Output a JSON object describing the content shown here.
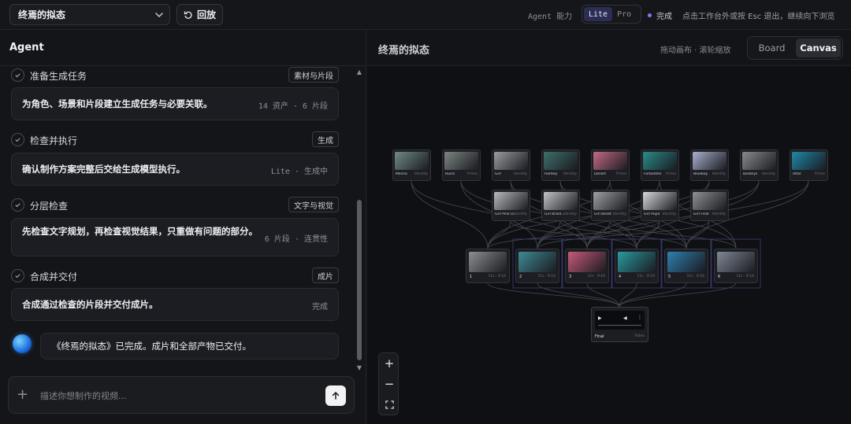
{
  "topbar": {
    "project_name": "终焉的拟态",
    "undo_label": "回放",
    "capability_label": "Agent 能力",
    "modes": [
      {
        "label": "Lite",
        "active": true
      },
      {
        "label": "Pro",
        "active": false
      }
    ],
    "status_label": "完成",
    "hint": "点击工作台外或按 Esc 退出，继续向下浏览"
  },
  "agent": {
    "title": "Agent",
    "steps": [
      {
        "title": "准备生成任务",
        "tag": "素材与片段",
        "text": "为角色、场景和片段建立生成任务与必要关联。",
        "meta": "14 资产 · 6 片段"
      },
      {
        "title": "检查并执行",
        "tag": "生成",
        "text": "确认制作方案完整后交给生成模型执行。",
        "meta": "Lite · 生成中"
      },
      {
        "title": "分层检查",
        "tag": "文字与视觉",
        "text": "先检查文字规划，再检查视觉结果，只重做有问题的部分。",
        "meta": "6 片段 · 连贯性"
      },
      {
        "title": "合成并交付",
        "tag": "成片",
        "text": "合成通过检查的片段并交付成片。",
        "meta": "完成"
      }
    ],
    "final_message": "《终焉的拟态》已完成。成片和全部产物已交付。",
    "composer_placeholder": "描述你想制作的视频..."
  },
  "canvas": {
    "title": "终焉的拟态",
    "hint": "拖动画布 · 滚轮缩放",
    "views": [
      {
        "label": "Board",
        "active": false
      },
      {
        "label": "Canvas",
        "active": true
      }
    ],
    "scene_nodes": [
      {
        "label": "Mecha",
        "tag": "Identity",
        "color": "#6f8a86"
      },
      {
        "label": "Ruins",
        "tag": "Prime",
        "color": "#7c8580"
      },
      {
        "label": "Girl",
        "tag": "Identity",
        "color": "#9a9ca0"
      },
      {
        "label": "Harbey",
        "tag": "Identity",
        "color": "#3f6e6a"
      },
      {
        "label": "Desert",
        "tag": "Prime",
        "color": "#c46a86"
      },
      {
        "label": "Forbidden",
        "tag": "Prime",
        "color": "#2a8c88"
      },
      {
        "label": "Bluebay",
        "tag": "Identity",
        "color": "#a8b0cc"
      },
      {
        "label": "Barbeys",
        "tag": "Identity",
        "color": "#8a8a8c"
      },
      {
        "label": "Altar",
        "tag": "Prime",
        "color": "#1f88a8"
      }
    ],
    "char_nodes": [
      {
        "label": "Girl Pink O...",
        "tag": "Identity",
        "color": "#b8b9bc"
      },
      {
        "label": "Girl Braid...",
        "tag": "Identity",
        "color": "#c2c3c6"
      },
      {
        "label": "Girl Beast",
        "tag": "Identity",
        "color": "#9fa0a4"
      },
      {
        "label": "Girl Pupil",
        "tag": "Identity",
        "color": "#d6d7da"
      },
      {
        "label": "Girl Final",
        "tag": "Identity",
        "color": "#8f9094"
      }
    ],
    "shots": [
      {
        "label": "1",
        "tag": "11s · 9:16",
        "color": "#8b8e92"
      },
      {
        "label": "2",
        "tag": "11s · 9:16",
        "color": "#3f8a94"
      },
      {
        "label": "3",
        "tag": "11s · 9:16",
        "color": "#c75a7a"
      },
      {
        "label": "4",
        "tag": "11s · 9:16",
        "color": "#2a9aa0"
      },
      {
        "label": "5",
        "tag": "11s · 9:16",
        "color": "#2f7fb0"
      },
      {
        "label": "6",
        "tag": "11s · 9:16",
        "color": "#7f8896"
      }
    ],
    "final": {
      "label": "Final",
      "tag": "Video"
    }
  }
}
